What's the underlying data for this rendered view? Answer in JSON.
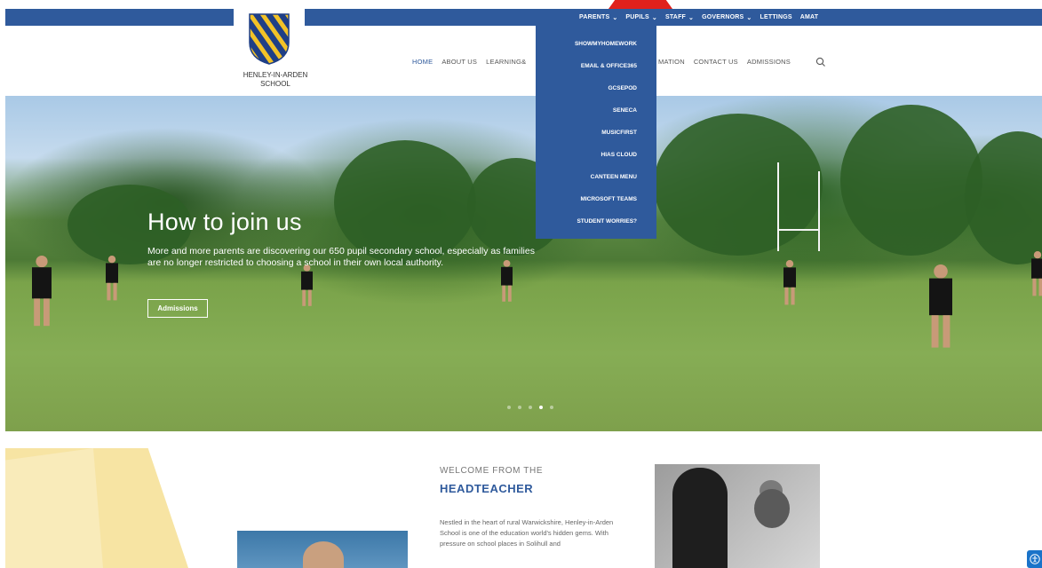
{
  "topbar": {
    "items": [
      {
        "label": "PARENTS",
        "dropdown": true
      },
      {
        "label": "PUPILS",
        "dropdown": true
      },
      {
        "label": "STAFF",
        "dropdown": true
      },
      {
        "label": "GOVERNORS",
        "dropdown": true
      },
      {
        "label": "LETTINGS",
        "dropdown": false
      },
      {
        "label": "AMAT",
        "dropdown": false
      }
    ]
  },
  "logo": {
    "line1": "HENLEY-IN-ARDEN",
    "line2": "SCHOOL"
  },
  "mainnav": {
    "home": "HOME",
    "about": "ABOUT US",
    "learning": "LEARNING&",
    "information": "MATION",
    "contact": "CONTACT US",
    "admissions": "ADMISSIONS"
  },
  "dropdown": {
    "items": [
      "SHOWMYHOMEWORK",
      "EMAIL & OFFICE365",
      "GCSEPOD",
      "SENECA",
      "MUSICFIRST",
      "HIAS CLOUD",
      "CANTEEN MENU",
      "MICROSOFT TEAMS",
      "STUDENT WORRIES?"
    ]
  },
  "hero": {
    "title": "How to join us",
    "text": "More and more parents are discovering our 650 pupil secondary school, especially as families are no longer restricted to choosing a school in their own local authority.",
    "button": "Admissions"
  },
  "welcome": {
    "small": "WELCOME FROM THE",
    "big": "HEADTEACHER",
    "text": "Nestled in the heart of rural Warwickshire, Henley-in-Arden School is one of the education world's hidden gems.  With pressure on school places in Solihull and"
  },
  "colors": {
    "brand_blue": "#2f5a9c",
    "accent_yellow": "#f7e4a3",
    "tab_red": "#e0211c"
  },
  "icons": {
    "search": "search-icon",
    "chevron": "chevron-down-icon",
    "accessibility": "accessibility-icon"
  }
}
